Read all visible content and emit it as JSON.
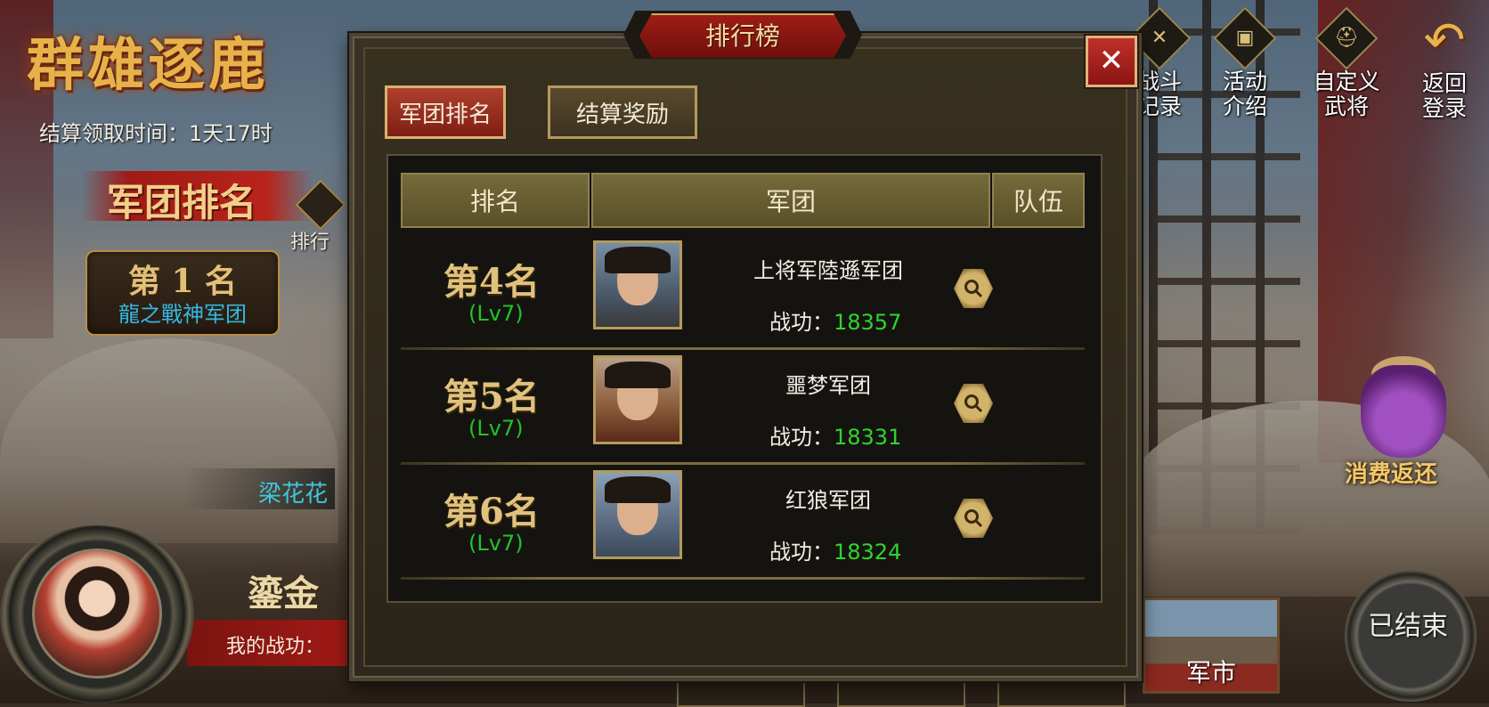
{
  "game": {
    "title": "群雄逐鹿",
    "settle_time": "结算领取时间：1天17时",
    "legion_rank_title": "军团排名",
    "rank_tab_label": "排行",
    "first_place": {
      "rank": "第 1 名",
      "legion": "龍之戰神军团"
    },
    "player_name": "梁花花",
    "gilded_text": "鎏金",
    "my_merit_label": "我的战功："
  },
  "top_menu": [
    {
      "icon": "crossed-swords-icon",
      "glyph": "✕",
      "label": "战斗记录"
    },
    {
      "icon": "event-scroll-icon",
      "glyph": "▣",
      "label": "活动介绍"
    },
    {
      "icon": "helmet-icon",
      "glyph": "⛑",
      "label": "自定义武将"
    },
    {
      "icon": "back-arrow-icon",
      "glyph": "↶",
      "label": "返回登录"
    }
  ],
  "side": {
    "consume_rebate": "消费返还",
    "ended": "已结束",
    "market": "军市"
  },
  "dialog": {
    "title": "排行榜",
    "close_glyph": "✕",
    "tabs": [
      {
        "label": "军团排名",
        "active": true
      },
      {
        "label": "结算奖励",
        "active": false
      }
    ],
    "columns": [
      "排名",
      "军团",
      "队伍"
    ],
    "merit_label": "战功：",
    "rows": [
      {
        "rank": "第4名",
        "level": "(Lv7)",
        "legion": "上将军陸遜军团",
        "merit": "18357"
      },
      {
        "rank": "第5名",
        "level": "(Lv7)",
        "legion": "噩梦军团",
        "merit": "18331"
      },
      {
        "rank": "第6名",
        "level": "(Lv7)",
        "legion": "红狼军团",
        "merit": "18324"
      }
    ]
  },
  "colors": {
    "accent_gold": "#e0c27e",
    "title_red": "#9e1d16",
    "level_green": "#22c22a",
    "merit_green": "#2fd42f",
    "first_legion_blue": "#34b8e0"
  }
}
